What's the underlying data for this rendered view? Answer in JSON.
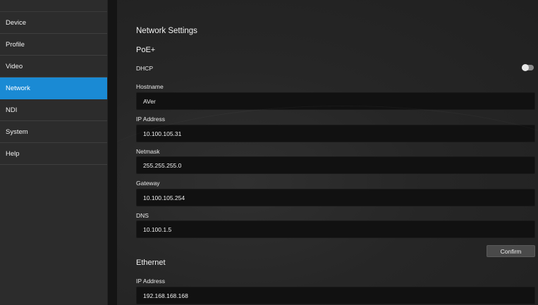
{
  "sidebar": {
    "items": [
      {
        "label": "Device"
      },
      {
        "label": "Profile"
      },
      {
        "label": "Video"
      },
      {
        "label": "Network"
      },
      {
        "label": "NDI"
      },
      {
        "label": "System"
      },
      {
        "label": "Help"
      }
    ],
    "active": "Network"
  },
  "main": {
    "title": "Network Settings",
    "poe": {
      "section_title": "PoE+",
      "dhcp_label": "DHCP",
      "dhcp_enabled": false,
      "hostname_label": "Hostname",
      "hostname_value": "AVer",
      "ip_label": "IP Address",
      "ip_value": "10.100.105.31",
      "netmask_label": "Netmask",
      "netmask_value": "255.255.255.0",
      "gateway_label": "Gateway",
      "gateway_value": "10.100.105.254",
      "dns_label": "DNS",
      "dns_value": "10.100.1.5",
      "confirm_label": "Confirm"
    },
    "ethernet": {
      "section_title": "Ethernet",
      "ip_label": "IP Address",
      "ip_value": "192.168.168.168"
    }
  },
  "colors": {
    "accent": "#1a8ad4",
    "sidebar_bg": "#2c2c2c",
    "main_bg": "#262626",
    "input_bg": "#111111"
  }
}
